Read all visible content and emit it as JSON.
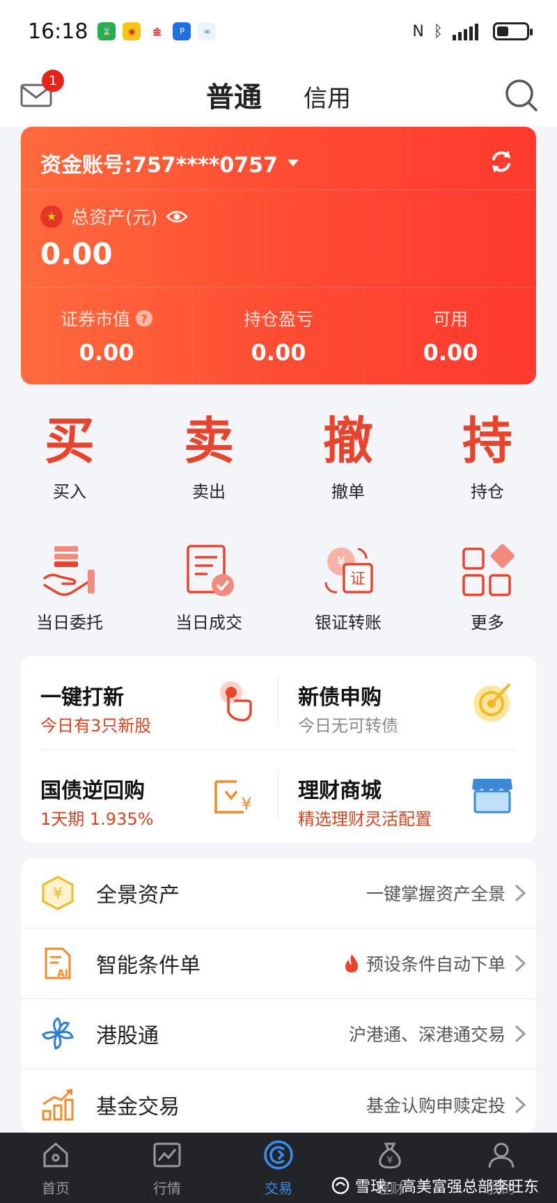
{
  "status_bar": {
    "time": "16:18",
    "apps": [
      "app1",
      "weibo",
      "jindong",
      "app4",
      "app5"
    ]
  },
  "header": {
    "mail_badge": "1",
    "tabs": [
      {
        "label": "普通",
        "active": true
      },
      {
        "label": "信用",
        "active": false
      }
    ]
  },
  "account": {
    "label": "资金账号:757****0757",
    "total_label": "总资产(元)",
    "total_value": "0.00",
    "stats": [
      {
        "label": "证券市值",
        "value": "0.00",
        "help": "?"
      },
      {
        "label": "持仓盈亏",
        "value": "0.00"
      },
      {
        "label": "可用",
        "value": "0.00"
      }
    ]
  },
  "trade_actions": [
    {
      "glyph": "买",
      "label": "买入"
    },
    {
      "glyph": "卖",
      "label": "卖出"
    },
    {
      "glyph": "撤",
      "label": "撤单"
    },
    {
      "glyph": "持",
      "label": "持仓"
    }
  ],
  "tools": [
    {
      "label": "当日委托",
      "icon": "entrust-hand-icon"
    },
    {
      "label": "当日成交",
      "icon": "deal-doc-icon"
    },
    {
      "label": "银证转账",
      "icon": "transfer-icon"
    },
    {
      "label": "更多",
      "icon": "more-grid-icon"
    }
  ],
  "quick_panel": [
    {
      "title": "一键打新",
      "sub": "今日有3只新股",
      "sub_style": "red"
    },
    {
      "title": "新债申购",
      "sub": "今日无可转债",
      "sub_style": "gray"
    },
    {
      "title": "国债逆回购",
      "sub": "1天期 1.935%",
      "sub_style": "red"
    },
    {
      "title": "理财商城",
      "sub": "精选理财灵活配置",
      "sub_style": "red"
    }
  ],
  "services": [
    {
      "name": "全景资产",
      "desc": "一键掌握资产全景"
    },
    {
      "name": "智能条件单",
      "desc": "预设条件自动下单"
    },
    {
      "name": "港股通",
      "desc": "沪港通、深港通交易"
    },
    {
      "name": "基金交易",
      "desc": "基金认购申赎定投"
    }
  ],
  "bottom_nav": [
    {
      "label": "首页",
      "active": false
    },
    {
      "label": "行情",
      "active": false
    },
    {
      "label": "交易",
      "active": true
    },
    {
      "label": "理财",
      "active": false
    },
    {
      "label": "我的",
      "active": false
    }
  ],
  "watermark": "雪球：高美富强总部李旺东",
  "colors": {
    "accent_red": "#e8432d",
    "card_gradient_start": "#ff6a3c",
    "card_gradient_end": "#ff3a2e",
    "nav_active": "#3a8cf0",
    "nav_bg": "#232428"
  }
}
